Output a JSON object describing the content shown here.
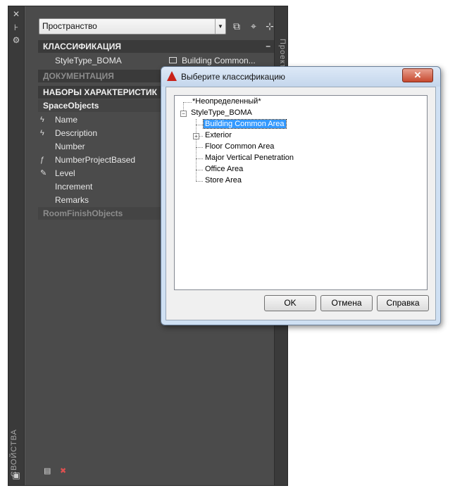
{
  "palette": {
    "vertical_title": "СВОЙСТВА",
    "right_tab": "Проект",
    "dropdown_value": "Пространство",
    "sections": {
      "classification": "КЛАССИФИКАЦИЯ",
      "documentation": "ДОКУМЕНТАЦИЯ",
      "property_sets": "НАБОРЫ ХАРАКТЕРИСТИК",
      "space_objects": "SpaceObjects",
      "room_finish": "RoomFinishObjects"
    },
    "classification_row": {
      "name": "StyleType_BOMA",
      "value": "Building  Common..."
    },
    "properties": [
      "Name",
      "Description",
      "Number",
      "NumberProjectBased",
      "Level",
      "Increment",
      "Remarks"
    ],
    "collapse_symbol": "–"
  },
  "dialog": {
    "title": "Выберите классификацию",
    "close": "✕",
    "tree": {
      "undefined": "*Неопределенный*",
      "root": "StyleType_BOMA",
      "children": [
        "Building Common Area",
        "Exterior",
        "Floor Common Area",
        "Major Vertical Penetration",
        "Office Area",
        "Store Area"
      ]
    },
    "buttons": {
      "ok": "OK",
      "cancel": "Отмена",
      "help": "Справка"
    }
  }
}
